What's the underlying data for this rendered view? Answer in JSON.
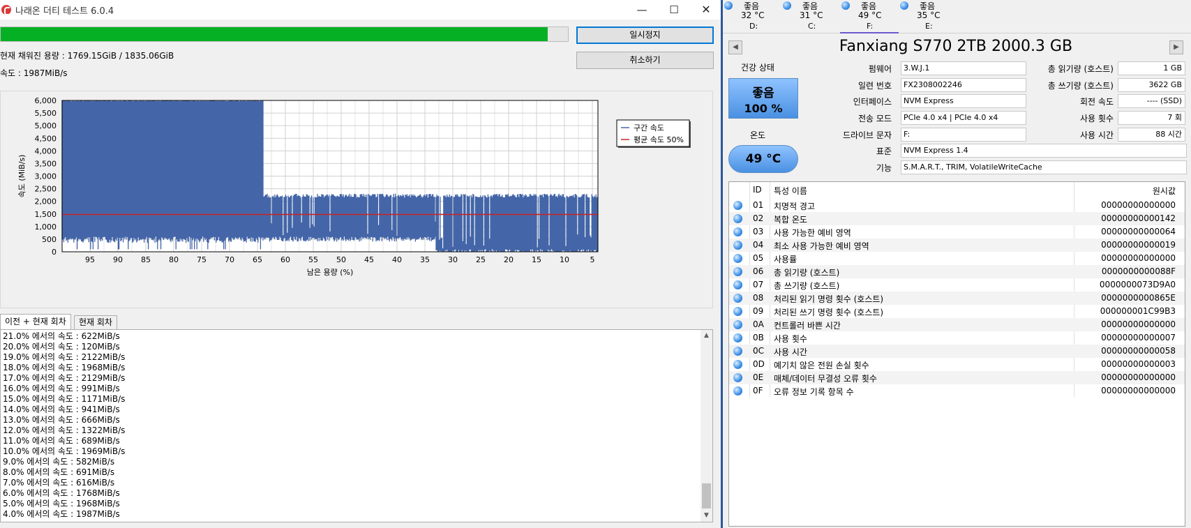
{
  "left": {
    "title": "나래온 더티 테스트 6.0.4",
    "window_controls": {
      "minimize": "—",
      "maximize": "☐",
      "close": "✕"
    },
    "progress_fraction": 0.964,
    "filled_capacity": "현재 채워진 용량 : 1769.15GiB / 1835.06GiB",
    "speed": "속도 : 1987MiB/s",
    "buttons": {
      "pause": "일시정지",
      "cancel": "취소하기"
    },
    "tabs": [
      "이전 + 현재 회차",
      "현재 회차"
    ],
    "log": [
      "21.0% 에서의 속도 : 622MiB/s",
      "20.0% 에서의 속도 : 120MiB/s",
      "19.0% 에서의 속도 : 2122MiB/s",
      "18.0% 에서의 속도 : 1968MiB/s",
      "17.0% 에서의 속도 : 2129MiB/s",
      "16.0% 에서의 속도 : 991MiB/s",
      "15.0% 에서의 속도 : 1171MiB/s",
      "14.0% 에서의 속도 : 941MiB/s",
      "13.0% 에서의 속도 : 666MiB/s",
      "12.0% 에서의 속도 : 1322MiB/s",
      "11.0% 에서의 속도 : 689MiB/s",
      "10.0% 에서의 속도 : 1969MiB/s",
      "9.0% 에서의 속도 : 582MiB/s",
      "8.0% 에서의 속도 : 691MiB/s",
      "7.0% 에서의 속도 : 616MiB/s",
      "6.0% 에서의 속도 : 1768MiB/s",
      "5.0% 에서의 속도 : 1968MiB/s",
      "4.0% 에서의 속도 : 1987MiB/s"
    ]
  },
  "chart_data": {
    "type": "area",
    "xlabel": "남은 용량 (%)",
    "ylabel": "속도 (MiB/s)",
    "xlim": [
      100,
      4
    ],
    "ylim": [
      0,
      6000
    ],
    "x_reversed": true,
    "grid": true,
    "x_ticks": [
      "95",
      "90",
      "85",
      "80",
      "75",
      "70",
      "65",
      "60",
      "55",
      "50",
      "45",
      "40",
      "35",
      "30",
      "25",
      "20",
      "15",
      "10",
      "5"
    ],
    "y_ticks": [
      "0",
      "500",
      "1,000",
      "1,500",
      "2,000",
      "2,500",
      "3,000",
      "3,500",
      "4,000",
      "4,500",
      "5,000",
      "5,500",
      "6,000"
    ],
    "series": [
      {
        "name": "구간 속도",
        "color": "#4466a8",
        "segments": [
          {
            "x_from": 100,
            "x_to": 64,
            "high": 6000,
            "low": 600
          },
          {
            "x_from": 64,
            "x_to": 33,
            "high": 2300,
            "low": 600
          },
          {
            "x_from": 33,
            "x_to": 4,
            "high": 2300,
            "low": 100
          }
        ]
      },
      {
        "name": "평균 속도 50%",
        "color": "#cc2222",
        "y": 1480
      }
    ],
    "legend": {
      "position": "top-right",
      "entries": [
        "구간 속도",
        "평균 속도 50%"
      ]
    }
  },
  "right": {
    "drives": [
      {
        "status": "좋음",
        "temp": "32 °C",
        "letter": "D:"
      },
      {
        "status": "좋음",
        "temp": "31 °C",
        "letter": "C:"
      },
      {
        "status": "좋음",
        "temp": "49 °C",
        "letter": "F:"
      },
      {
        "status": "좋음",
        "temp": "35 °C",
        "letter": "E:"
      }
    ],
    "disk_title": "Fanxiang S770 2TB 2000.3 GB",
    "nav_prev": "◀",
    "nav_next": "▶",
    "health": {
      "label": "건강 상태",
      "status": "좋음",
      "percent": "100 %"
    },
    "temperature": {
      "label": "온도",
      "value": "49 °C"
    },
    "info": [
      {
        "label": "펌웨어",
        "value": "3.W.J.1"
      },
      {
        "label": "일련 번호",
        "value": "FX2308002246"
      },
      {
        "label": "인터페이스",
        "value": "NVM Express"
      },
      {
        "label": "전송 모드",
        "value": "PCIe 4.0 x4 | PCIe 4.0 x4"
      },
      {
        "label": "드라이브 문자",
        "value": "F:"
      },
      {
        "label": "표준",
        "value": "NVM Express 1.4"
      },
      {
        "label": "기능",
        "value": "S.M.A.R.T., TRIM, VolatileWriteCache"
      }
    ],
    "side_info": [
      {
        "label": "총 읽기량 (호스트)",
        "value": "1 GB"
      },
      {
        "label": "총 쓰기량 (호스트)",
        "value": "3622 GB"
      },
      {
        "label": "회전 속도",
        "value": "---- (SSD)"
      },
      {
        "label": "사용 횟수",
        "value": "7 회"
      },
      {
        "label": "사용 시간",
        "value": "88 시간"
      }
    ],
    "smart_headers": {
      "id": "ID",
      "name": "특성 이름",
      "raw": "원시값"
    },
    "smart": [
      {
        "id": "01",
        "name": "치명적 경고",
        "raw": "00000000000000"
      },
      {
        "id": "02",
        "name": "복합 온도",
        "raw": "00000000000142"
      },
      {
        "id": "03",
        "name": "사용 가능한 예비 영역",
        "raw": "00000000000064"
      },
      {
        "id": "04",
        "name": "최소 사용 가능한 예비 영역",
        "raw": "00000000000019"
      },
      {
        "id": "05",
        "name": "사용률",
        "raw": "00000000000000"
      },
      {
        "id": "06",
        "name": "총 읽기량 (호스트)",
        "raw": "0000000000088F"
      },
      {
        "id": "07",
        "name": "총 쓰기량 (호스트)",
        "raw": "0000000073D9A0"
      },
      {
        "id": "08",
        "name": "처리된 읽기 명령 횟수 (호스트)",
        "raw": "0000000000865E"
      },
      {
        "id": "09",
        "name": "처리된 쓰기 명령 횟수 (호스트)",
        "raw": "000000001C99B3"
      },
      {
        "id": "0A",
        "name": "컨트롤러 바쁜 시간",
        "raw": "00000000000000"
      },
      {
        "id": "0B",
        "name": "사용 횟수",
        "raw": "00000000000007"
      },
      {
        "id": "0C",
        "name": "사용 시간",
        "raw": "00000000000058"
      },
      {
        "id": "0D",
        "name": "예기치 않은 전원 손실 횟수",
        "raw": "00000000000003"
      },
      {
        "id": "0E",
        "name": "매체/데이터 무결성 오류 횟수",
        "raw": "00000000000000"
      },
      {
        "id": "0F",
        "name": "오류 정보 기록 항목 수",
        "raw": "00000000000000"
      }
    ]
  }
}
